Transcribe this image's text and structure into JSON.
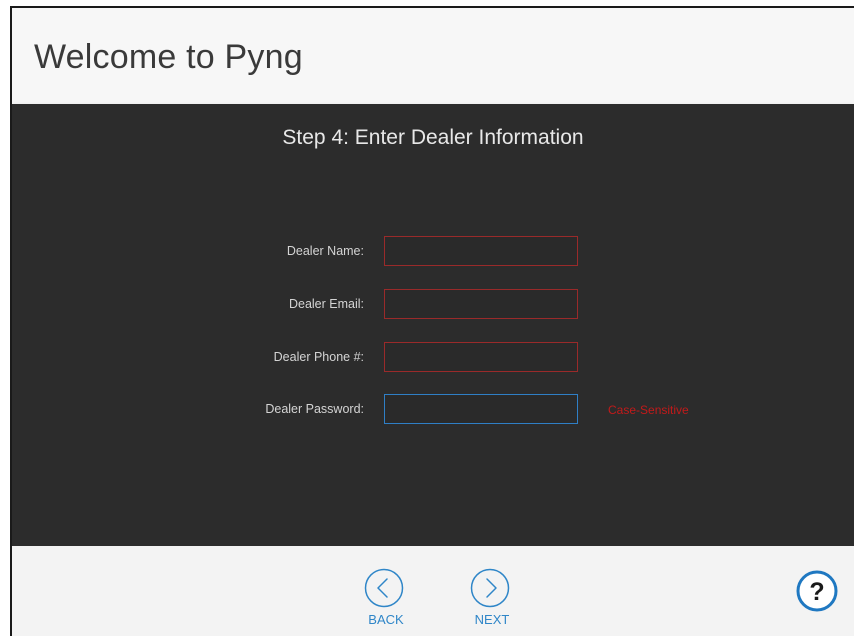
{
  "app": {
    "title": "Welcome to Pyng"
  },
  "step": {
    "title": "Step 4: Enter Dealer Information"
  },
  "form": {
    "dealer_name": {
      "label": "Dealer Name:",
      "value": ""
    },
    "dealer_email": {
      "label": "Dealer Email:",
      "value": ""
    },
    "dealer_phone": {
      "label": "Dealer Phone #:",
      "value": ""
    },
    "dealer_password": {
      "label": "Dealer Password:",
      "value": "",
      "hint": "Case-Sensitive"
    }
  },
  "footer": {
    "back_label": "BACK",
    "next_label": "NEXT",
    "help_glyph": "?"
  },
  "colors": {
    "panel": "#2c2c2c",
    "accent_blue": "#2f86c8",
    "error_red": "#c21a1a",
    "input_border_red": "#9a2a2a",
    "focus_border_blue": "#2f7fc6"
  },
  "icons": {
    "back": "chevron-left-circle-icon",
    "next": "chevron-right-circle-icon",
    "help": "question-circle-icon"
  }
}
